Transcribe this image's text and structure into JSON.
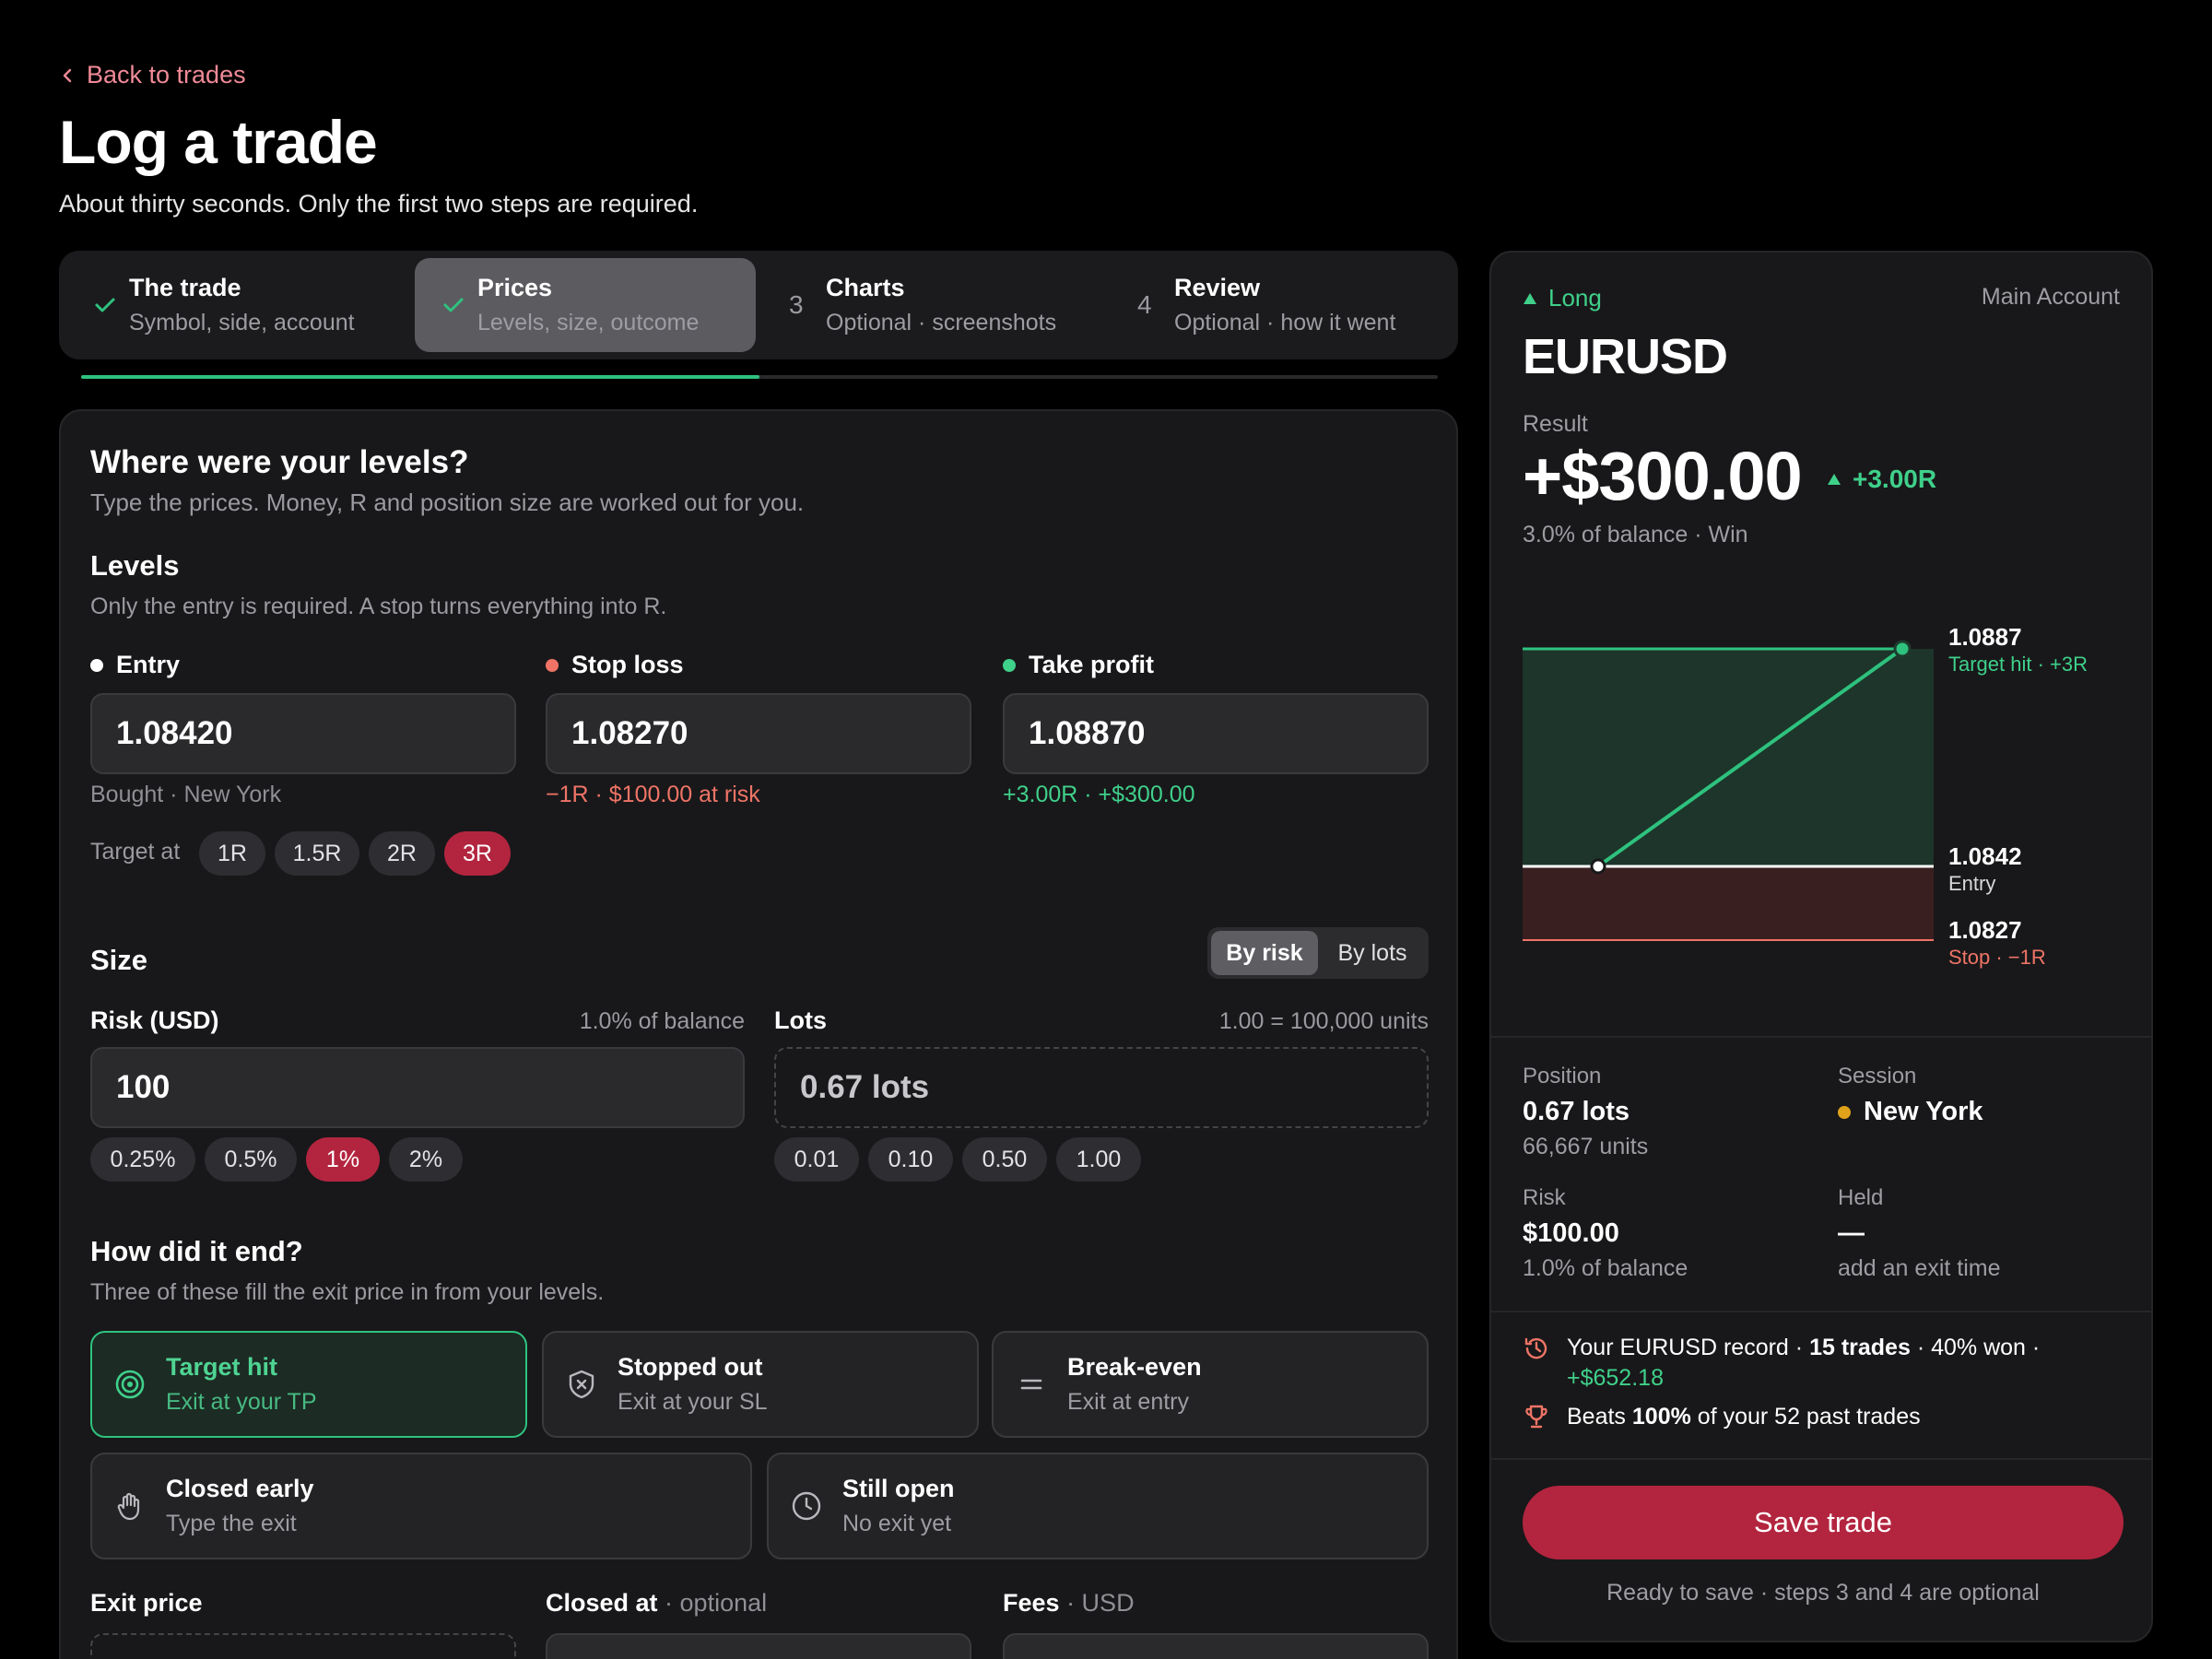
{
  "header": {
    "back_label": "Back to trades",
    "title": "Log a trade",
    "subtitle": "About thirty seconds. Only the first two steps are required."
  },
  "stepper": {
    "progress": 0.5,
    "steps": [
      {
        "marker": "check",
        "title": "The trade",
        "subtitle": "Symbol, side, account"
      },
      {
        "marker": "check",
        "title": "Prices",
        "subtitle": "Levels, size, outcome"
      },
      {
        "marker": "3",
        "title": "Charts",
        "subtitle": "Optional · screenshots"
      },
      {
        "marker": "4",
        "title": "Review",
        "subtitle": "Optional · how it went"
      }
    ]
  },
  "form": {
    "title": "Where were your levels?",
    "description": "Type the prices. Money, R and position size are worked out for you.",
    "levels": {
      "title": "Levels",
      "description": "Only the entry is required. A stop turns everything into R.",
      "entry": {
        "label": "Entry",
        "value": "1.08420",
        "note": "Bought · New York"
      },
      "stop": {
        "label": "Stop loss",
        "value": "1.08270",
        "note": "−1R · $100.00 at risk"
      },
      "tp": {
        "label": "Take profit",
        "value": "1.08870",
        "note": "+3.00R · +$300.00"
      },
      "target_label": "Target at",
      "target_chips": [
        "1R",
        "1.5R",
        "2R",
        "3R"
      ],
      "target_selected": "3R"
    },
    "size": {
      "title": "Size",
      "toggle": [
        "By risk",
        "By lots"
      ],
      "toggle_selected": "By risk",
      "risk_label": "Risk (USD)",
      "risk_hint": "1.0% of balance",
      "risk_value": "100",
      "risk_chips": [
        "0.25%",
        "0.5%",
        "1%",
        "2%"
      ],
      "risk_selected": "1%",
      "lots_label": "Lots",
      "lots_hint": "1.00 = 100,000 units",
      "lots_value": "0.67 lots",
      "lots_chips": [
        "0.01",
        "0.10",
        "0.50",
        "1.00"
      ]
    },
    "outcome": {
      "title": "How did it end?",
      "description": "Three of these fill the exit price in from your levels.",
      "options": [
        {
          "icon": "target-icon",
          "title": "Target hit",
          "subtitle": "Exit at your TP",
          "selected": true
        },
        {
          "icon": "shield-x-icon",
          "title": "Stopped out",
          "subtitle": "Exit at your SL",
          "selected": false
        },
        {
          "icon": "equals-icon",
          "title": "Break-even",
          "subtitle": "Exit at entry",
          "selected": false
        },
        {
          "icon": "hand-icon",
          "title": "Closed early",
          "subtitle": "Type the exit",
          "selected": false
        },
        {
          "icon": "clock-icon",
          "title": "Still open",
          "subtitle": "No exit yet",
          "selected": false
        }
      ]
    },
    "exit": {
      "exit_price_label": "Exit price",
      "closed_at_label": "Closed at",
      "closed_at_suffix": "· optional",
      "fees_label": "Fees",
      "fees_suffix": "· USD"
    }
  },
  "summary": {
    "side": "Long",
    "account": "Main Account",
    "symbol": "EURUSD",
    "result_label": "Result",
    "result_value": "+$300.00",
    "result_r": "+3.00R",
    "result_note": "3.0% of balance · Win",
    "chart": {
      "tp_price": "1.0887",
      "tp_label": "Target hit · +3R",
      "entry_price": "1.0842",
      "entry_label": "Entry",
      "stop_price": "1.0827",
      "stop_label": "Stop · −1R"
    },
    "position_label": "Position",
    "position_value": "0.67 lots",
    "position_units": "66,667 units",
    "session_label": "Session",
    "session_value": "New York",
    "risk_label": "Risk",
    "risk_value": "$100.00",
    "risk_note": "1.0% of balance",
    "held_label": "Held",
    "held_value": "—",
    "held_note": "add an exit time",
    "record": {
      "prefix": "Your EURUSD record ·",
      "trades": "15 trades",
      "won": "· 40% won ·",
      "pnl": "+$652.18"
    },
    "beats": {
      "prefix": "Beats",
      "pct": "100%",
      "suffix": "of your 52 past trades"
    },
    "save_label": "Save trade",
    "save_note": "Ready to save · steps 3 and 4 are optional"
  },
  "colors": {
    "accent_green": "#2ec27e",
    "accent_red": "#ef7466",
    "primary_button": "#b3253f",
    "background": "#000000"
  }
}
